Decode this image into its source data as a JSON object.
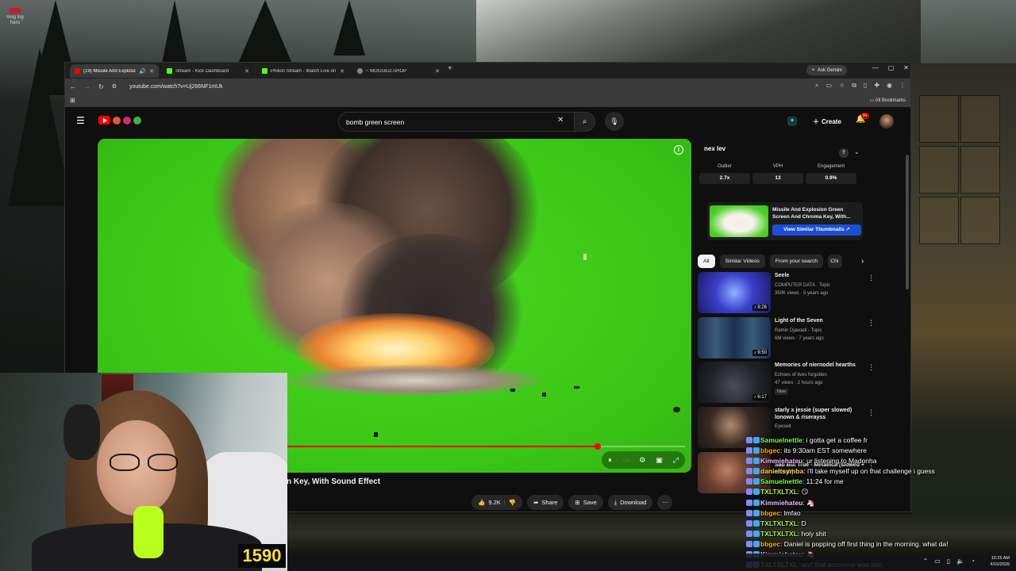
{
  "desktop": {
    "icon_label": "mog log hero"
  },
  "browser": {
    "tabs": [
      {
        "title": "(19) Missile And Explosion Green Screen",
        "color": "#ff0000",
        "active": true
      },
      {
        "title": "Stream - Kick Dashboard",
        "color": "#53fc18",
        "active": false
      },
      {
        "title": "Philion Stream - Watch Live on Kick",
        "color": "#53fc18",
        "active": false
      },
      {
        "title": "~ MOGGED.SHOP",
        "color": "#888888",
        "active": false
      }
    ],
    "new_tab": "+",
    "gemini": "Ask Gemini",
    "url": "youtube.com/watch?v=Uj266NF1mUk",
    "all_bookmarks": "All Bookmarks"
  },
  "youtube": {
    "search_value": "bomb green screen",
    "create_label": "Create",
    "notifications": "9+",
    "video_title_partial": "n Key, With Sound Effect",
    "progress_fraction": 0.85,
    "actions": {
      "likes": "9.2K",
      "share": "Share",
      "save": "Save",
      "download": "Download"
    },
    "ext": {
      "logo": "nex lev",
      "metrics": [
        {
          "label": "Outlier",
          "value": "2.7x"
        },
        {
          "label": "VPH",
          "value": "13"
        },
        {
          "label": "Engagement",
          "value": "0.9%"
        }
      ],
      "similar_title": "Missile And Explosion Green Screen And Chroma Key, With...",
      "similar_button": "View Similar Thumbnails"
    },
    "chips": [
      "All",
      "Similar Videos",
      "From your search",
      "Chi"
    ],
    "recommendations": [
      {
        "title": "Seele",
        "channel": "COMPUTER DATA · Topic",
        "meta": "350K views · 5 years ago",
        "duration": "8:26",
        "badge": ""
      },
      {
        "title": "Light of the Seven",
        "channel": "Ramin Djawadi - Topic",
        "meta": "6M views · 7 years ago",
        "duration": "9:50",
        "badge": ""
      },
      {
        "title": "Memories of niernodel hearths",
        "channel": "Echoes of lives forgotten",
        "meta": "47 views · 2 hours ago",
        "duration": "6:17",
        "badge": "New"
      },
      {
        "title": "starly x jessie (super slowed) lonown & riserayss",
        "channel": "Eyeswit",
        "meta": "",
        "duration": "",
        "badge": ""
      },
      {
        "title": "Sad But True - Metallica (slowed + reverb)",
        "channel": "",
        "meta": "",
        "duration": "",
        "badge": ""
      }
    ]
  },
  "stream": {
    "counter": "1590"
  },
  "chat": [
    {
      "user": "Samuelnettle",
      "color": "#7cfc4a",
      "text": " i gotta get a coffee fr"
    },
    {
      "user": "bbgec",
      "color": "#ffb000",
      "text": " its 9:30am EST somewhere"
    },
    {
      "user": "Kimmiehateu",
      "color": "#f2b8ff",
      "text": " ur listening to Madonha"
    },
    {
      "user": "danieltsymba",
      "color": "#ffd84a",
      "text": " i'll take myself up on that challenge i guess"
    },
    {
      "user": "Samuelnettle",
      "color": "#7cfc4a",
      "text": " 11:24 for me"
    },
    {
      "user": "TXLTXLTXL",
      "color": "#aef03a",
      "text": " 😏"
    },
    {
      "user": "Kimmiehateu",
      "color": "#f2b8ff",
      "text": " 🦄"
    },
    {
      "user": "bbgec",
      "color": "#ffb000",
      "text": " lmfao"
    },
    {
      "user": "TXLTXLTXL",
      "color": "#aef03a",
      "text": " D"
    },
    {
      "user": "TXLTXLTXL",
      "color": "#aef03a",
      "text": " holy shit"
    },
    {
      "user": "bbgec",
      "color": "#ffb000",
      "text": " Daniel is popping off first thing in the morning. what da!"
    },
    {
      "user": "Kimmiehateu",
      "color": "#f2b8ff",
      "text": " 🦄"
    },
    {
      "user": "TXLTXLTXL",
      "color": "#aef03a",
      "text": " and that someone was him"
    }
  ],
  "taskbar": {
    "time": "10:25 AM",
    "date": "4/10/2026"
  }
}
